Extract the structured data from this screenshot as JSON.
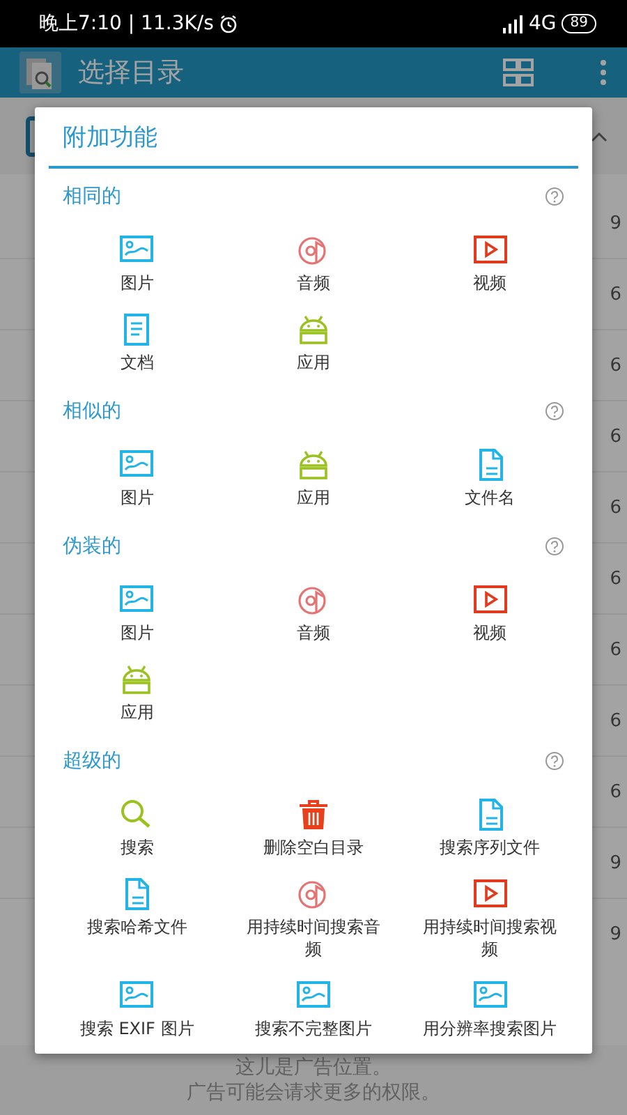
{
  "status_bar": {
    "time_speed": "晚上7:10 | 11.3K/s",
    "network": "4G",
    "battery": "89"
  },
  "app_bar": {
    "title": "选择目录"
  },
  "background_list": {
    "rows": [
      {
        "trailing": "9"
      },
      {
        "trailing": "6"
      },
      {
        "trailing": "6"
      },
      {
        "trailing": "6"
      },
      {
        "trailing": "6"
      },
      {
        "trailing": "6"
      },
      {
        "trailing": "6"
      },
      {
        "trailing": "6"
      },
      {
        "trailing": "6"
      },
      {
        "trailing": "9"
      },
      {
        "trailing": "9"
      }
    ]
  },
  "dialog": {
    "title": "附加功能",
    "sections": [
      {
        "title": "相同的",
        "items": [
          {
            "kind": "image",
            "label": "图片"
          },
          {
            "kind": "audio",
            "label": "音频"
          },
          {
            "kind": "video",
            "label": "视频"
          },
          {
            "kind": "document",
            "label": "文档"
          },
          {
            "kind": "app",
            "label": "应用"
          }
        ]
      },
      {
        "title": "相似的",
        "items": [
          {
            "kind": "image",
            "label": "图片"
          },
          {
            "kind": "app",
            "label": "应用"
          },
          {
            "kind": "file",
            "label": "文件名"
          }
        ]
      },
      {
        "title": "伪装的",
        "items": [
          {
            "kind": "image",
            "label": "图片"
          },
          {
            "kind": "audio",
            "label": "音频"
          },
          {
            "kind": "video",
            "label": "视频"
          },
          {
            "kind": "app",
            "label": "应用"
          }
        ]
      },
      {
        "title": "超级的",
        "items": [
          {
            "kind": "search",
            "label": "搜索"
          },
          {
            "kind": "trash",
            "label": "删除空白目录"
          },
          {
            "kind": "file",
            "label": "搜索序列文件"
          },
          {
            "kind": "file",
            "label": "搜索哈希文件"
          },
          {
            "kind": "audio",
            "label": "用持续时间搜索音频"
          },
          {
            "kind": "video",
            "label": "用持续时间搜索视频"
          },
          {
            "kind": "image",
            "label": "搜索 EXIF 图片"
          },
          {
            "kind": "image",
            "label": "搜索不完整图片"
          },
          {
            "kind": "image",
            "label": "用分辨率搜索图片"
          }
        ]
      }
    ]
  },
  "ad": {
    "lines": [
      "这儿是广告位置。",
      "广告可能会请求更多的权限。"
    ]
  }
}
